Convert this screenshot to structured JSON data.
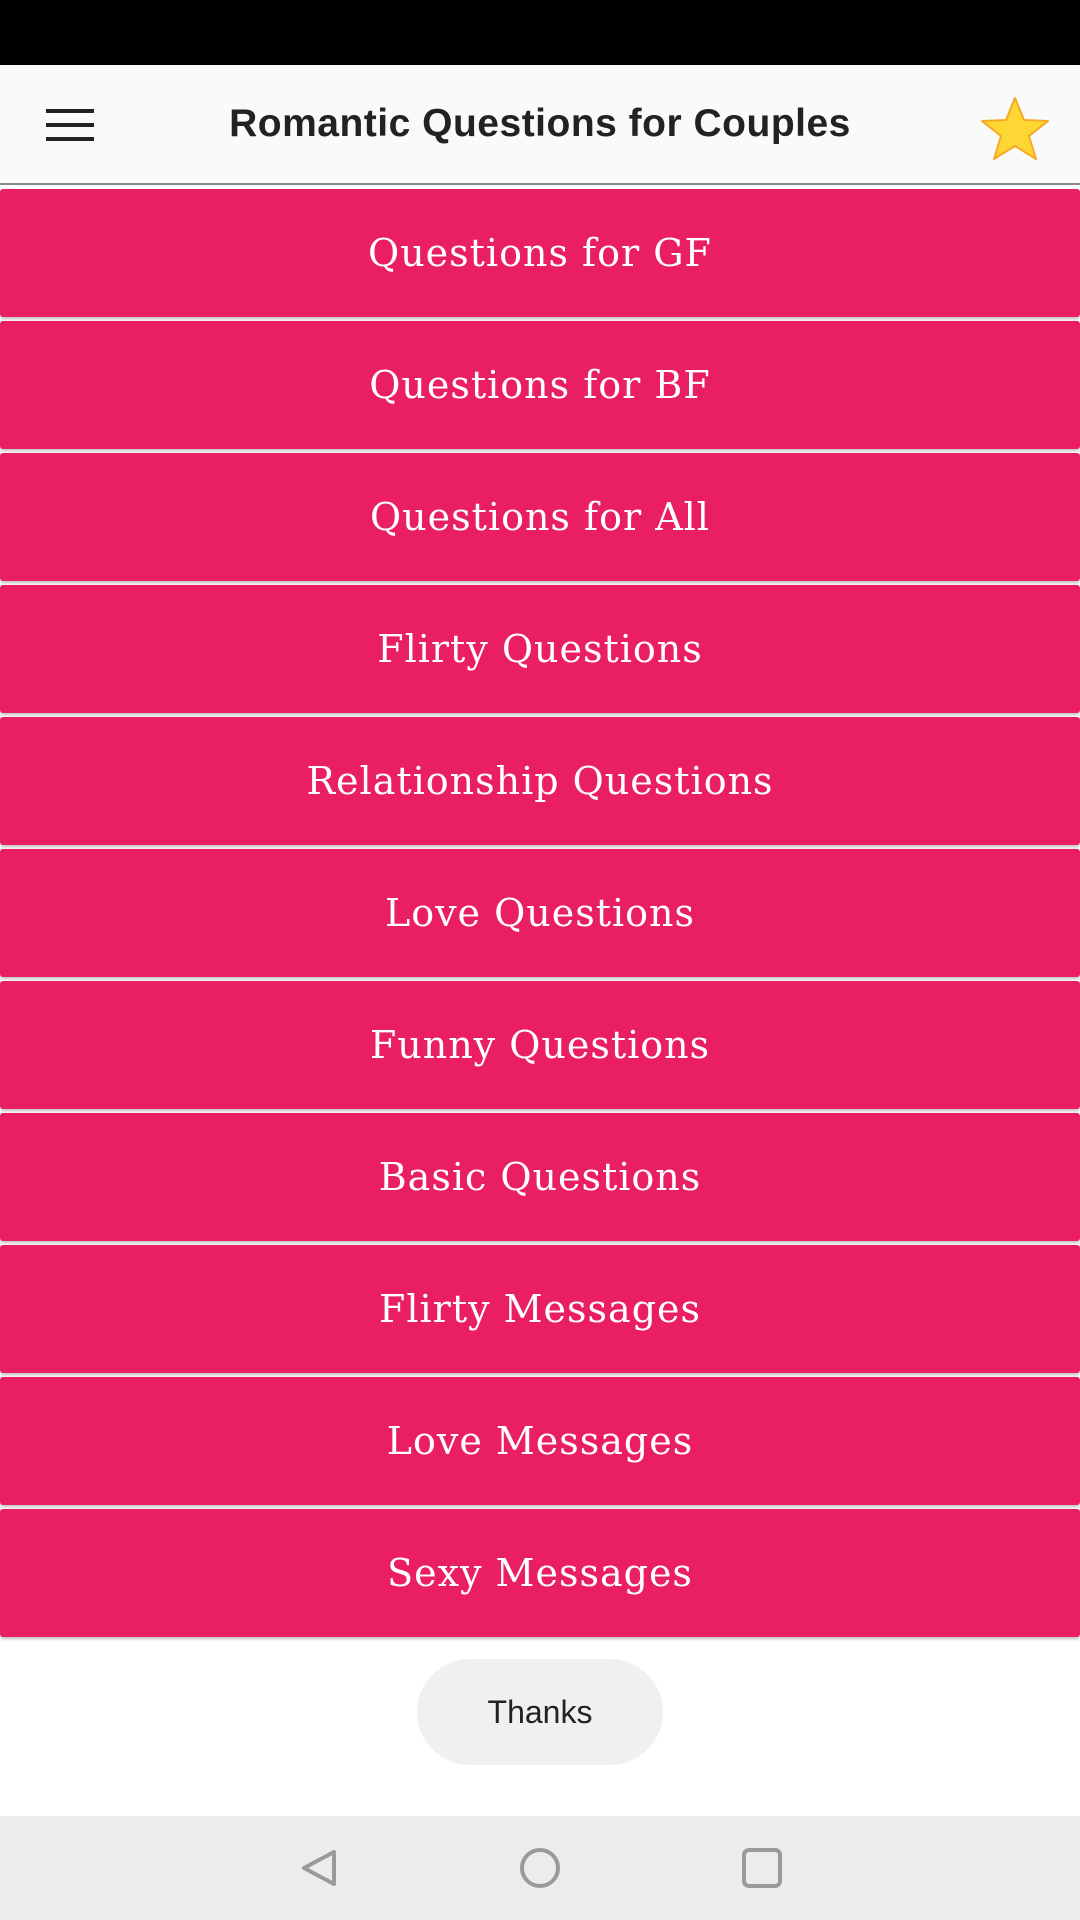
{
  "app_bar": {
    "title": "Romantic Questions for Couples",
    "menu_icon": "hamburger-menu-icon",
    "star_icon": "star-icon",
    "star_color": "#fdd835"
  },
  "menu": {
    "button_color": "#e91e63",
    "items": [
      {
        "label": "Questions for GF"
      },
      {
        "label": "Questions for BF"
      },
      {
        "label": "Questions for All"
      },
      {
        "label": "Flirty Questions"
      },
      {
        "label": "Relationship Questions"
      },
      {
        "label": "Love Questions"
      },
      {
        "label": "Funny Questions"
      },
      {
        "label": "Basic Questions"
      },
      {
        "label": "Flirty Messages"
      },
      {
        "label": "Love Messages"
      },
      {
        "label": "Sexy Messages"
      }
    ]
  },
  "footer": {
    "thanks_label": "Thanks"
  },
  "nav": {
    "back_icon": "back-triangle-icon",
    "home_icon": "home-circle-icon",
    "recents_icon": "recents-square-icon"
  }
}
